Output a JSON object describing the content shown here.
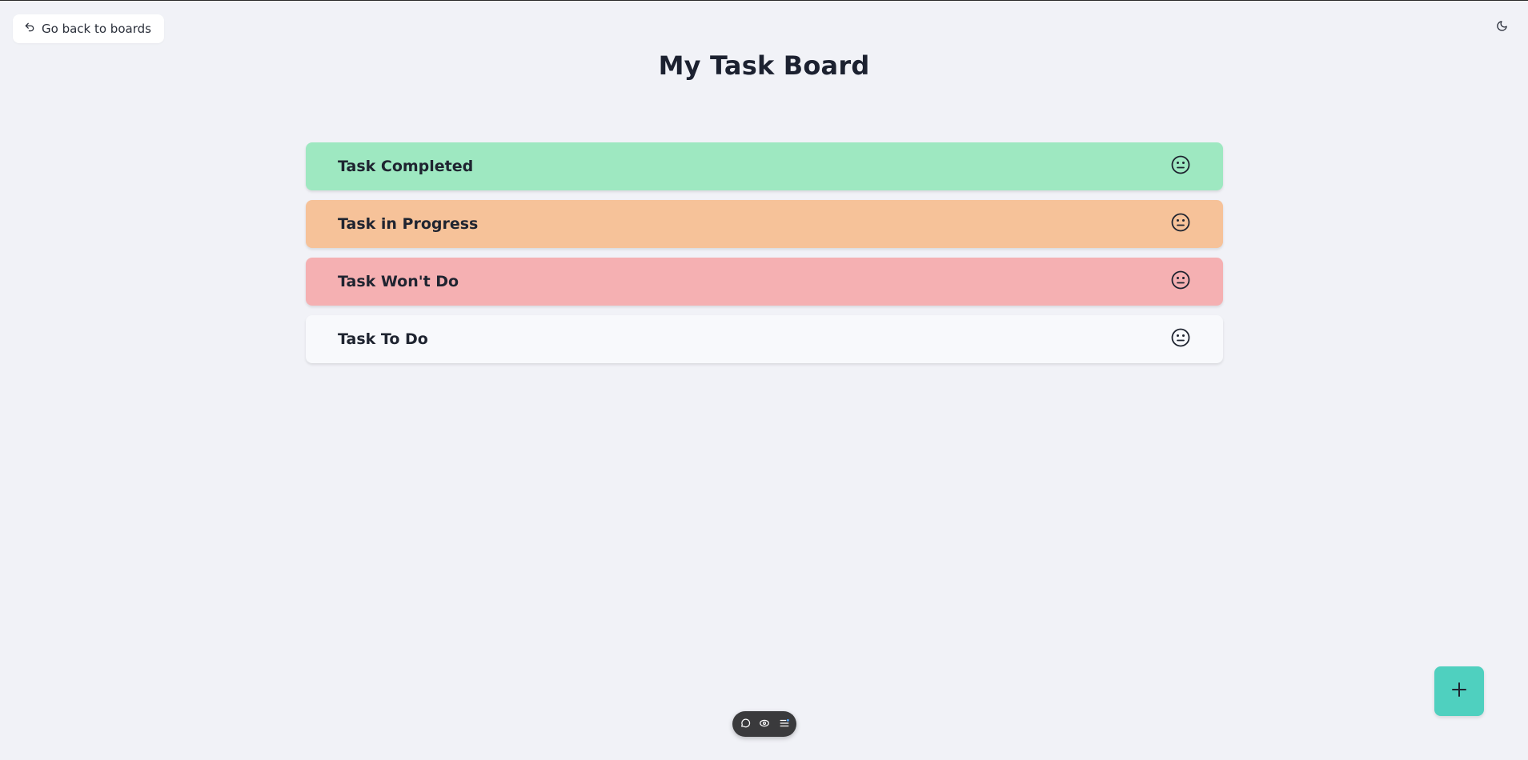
{
  "header": {
    "back_label": "Go back to boards",
    "title": "My Task Board"
  },
  "tasks": [
    {
      "title": "Task Completed",
      "status": "completed",
      "color": "#9ee8c1",
      "icon": "neutral-face-icon"
    },
    {
      "title": "Task in Progress",
      "status": "in-progress",
      "color": "#f6c299",
      "icon": "neutral-face-icon"
    },
    {
      "title": "Task Won't Do",
      "status": "wont-do",
      "color": "#f5b0b2",
      "icon": "neutral-face-icon"
    },
    {
      "title": "Task To Do",
      "status": "todo",
      "color": "#f8f9fc",
      "icon": "neutral-face-icon"
    }
  ],
  "icons": {
    "back": "undo-arrow-icon",
    "theme": "moon-icon",
    "add": "plus-icon",
    "toolbar": [
      "chat-bubble-icon",
      "eye-icon",
      "list-icon"
    ]
  },
  "colors": {
    "background": "#f1f2f7",
    "fab": "#4fd0bf",
    "toolbar": "#3a3a3c"
  }
}
